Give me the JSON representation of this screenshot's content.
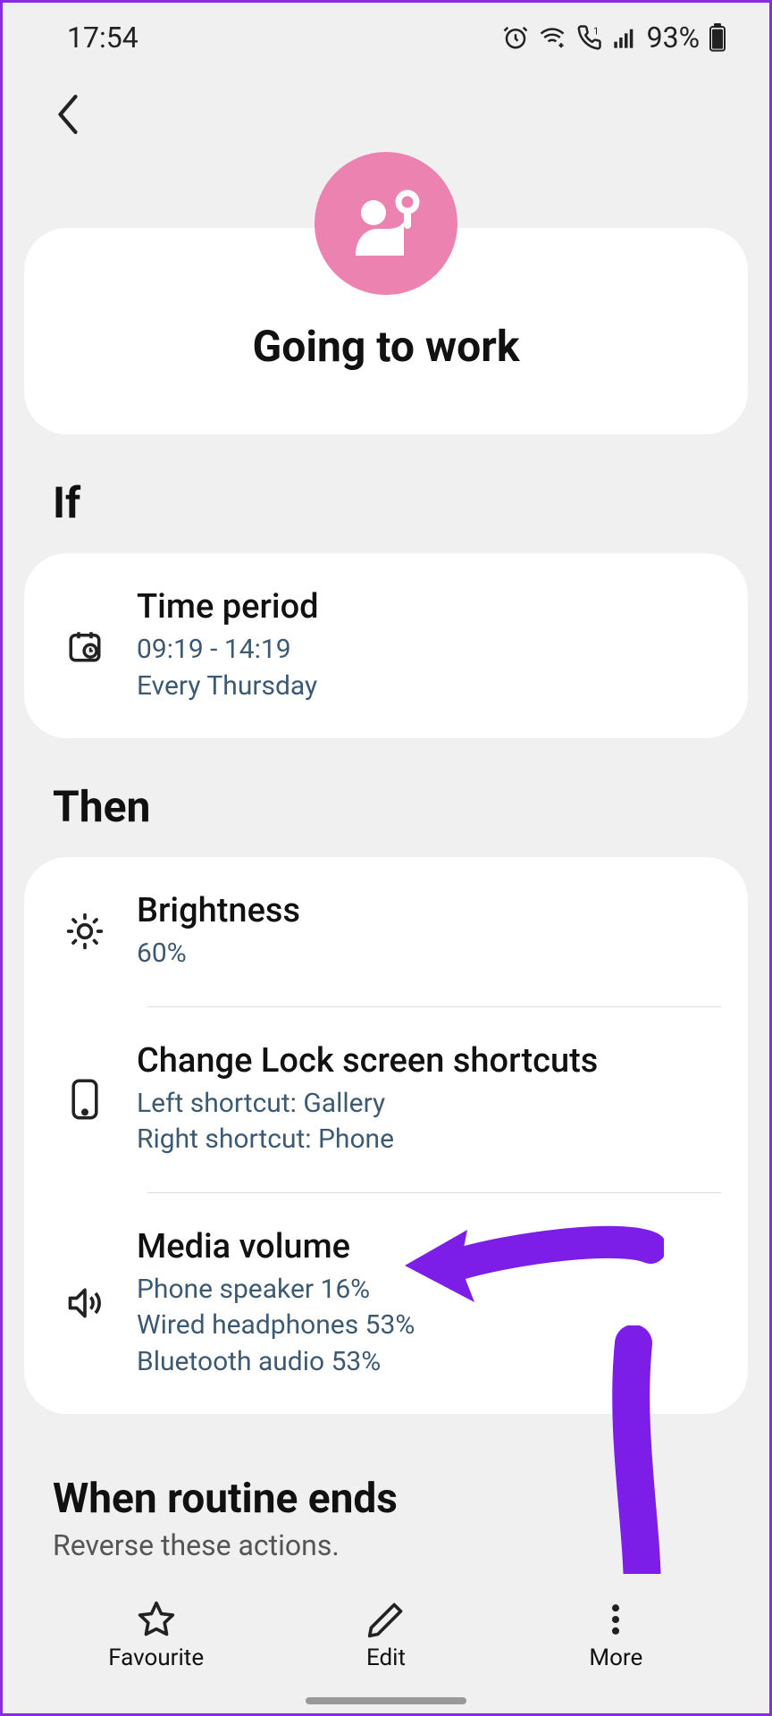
{
  "status": {
    "time": "17:54",
    "battery_text": "93%"
  },
  "routine": {
    "title": "Going to work"
  },
  "sections": {
    "if_label": "If",
    "then_label": "Then",
    "ends_heading": "When routine ends",
    "ends_sub": "Reverse these actions."
  },
  "if_items": [
    {
      "title": "Time period",
      "sub": "09:19 - 14:19\nEvery Thursday"
    }
  ],
  "then_items": [
    {
      "title": "Brightness",
      "sub": "60%"
    },
    {
      "title": "Change Lock screen shortcuts",
      "sub": "Left shortcut: Gallery\nRight shortcut: Phone"
    },
    {
      "title": "Media volume",
      "sub": "Phone speaker 16%\nWired headphones 53%\nBluetooth audio 53%"
    }
  ],
  "bottom_bar": {
    "favourite": "Favourite",
    "edit": "Edit",
    "more": "More"
  },
  "colors": {
    "accent_arrow": "#7c1de8",
    "hero_bg": "#ec82b0",
    "sub_text": "#3d5a72"
  }
}
